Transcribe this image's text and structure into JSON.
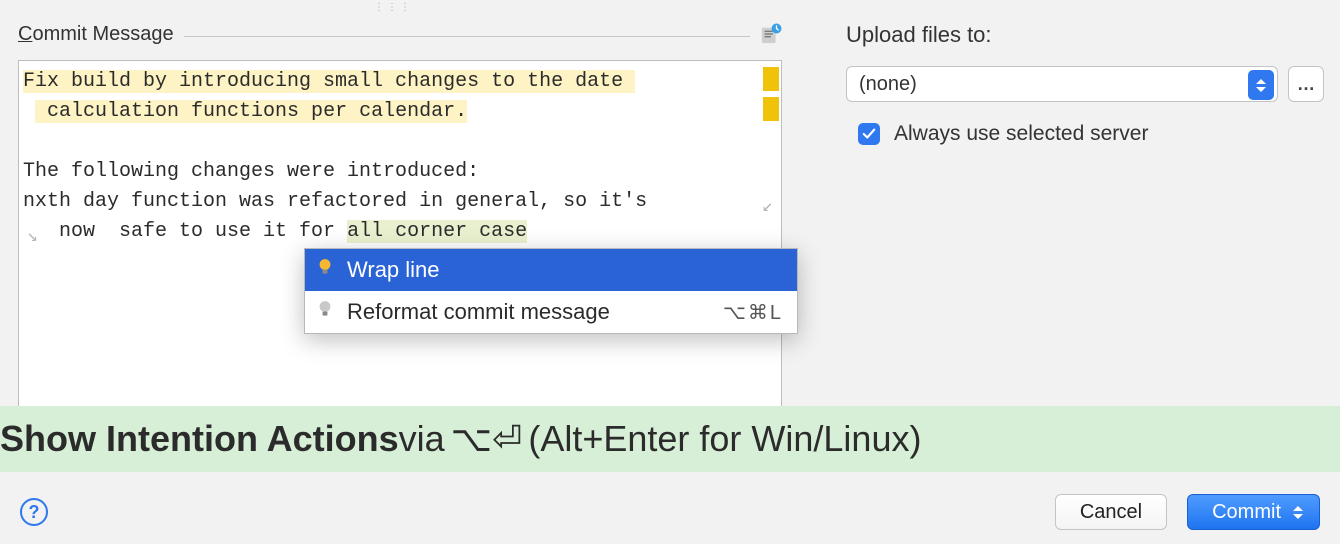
{
  "commit": {
    "section_label_html": "Commit Message",
    "lines": [
      {
        "text": "Fix build by introducing small changes to the date ",
        "hl": true,
        "wrap_right": false
      },
      {
        "text": " calculation functions per calendar.",
        "hl": true,
        "indent": true
      },
      {
        "text": ""
      },
      {
        "text": "The following changes were introduced:"
      },
      {
        "text": "nxth day function was refactored in general, so it's ",
        "wrap_right": true
      },
      {
        "text": " now  safe to use it for all corner case",
        "wrap_left": true,
        "hl_tail_from": 25
      }
    ]
  },
  "intent_popup": {
    "items": [
      {
        "label": "Wrap line",
        "selected": true,
        "shortcut": ""
      },
      {
        "label": "Reformat commit message",
        "selected": false,
        "shortcut": "⌥⌘L"
      }
    ]
  },
  "upload": {
    "label": "Upload files to:",
    "selected": "(none)",
    "checkbox_label": "Always use selected server",
    "checked": true
  },
  "banner": {
    "bold": "Show Intention Actions",
    "mid": " via ",
    "keys": "⌥⏎",
    "tail": " (Alt+Enter for Win/Linux)"
  },
  "buttons": {
    "cancel": "Cancel",
    "commit": "Commit"
  }
}
